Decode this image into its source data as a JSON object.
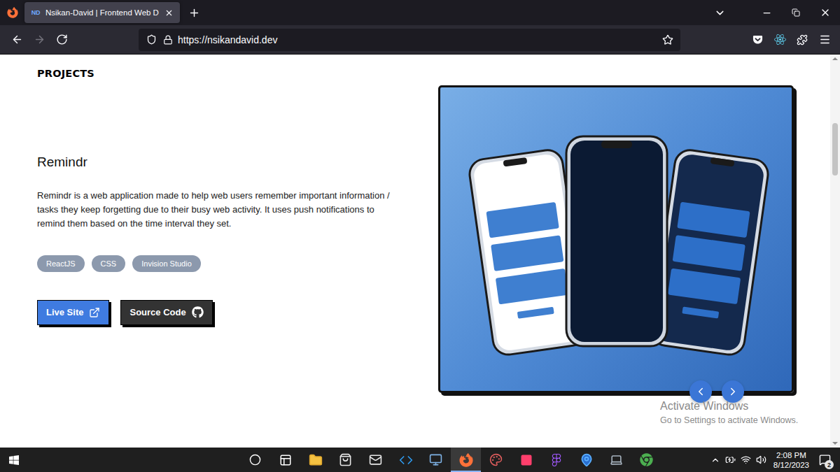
{
  "browser": {
    "tabs": [
      {
        "favicon": "ND",
        "title": "Nsikan-David | Frontend Web D",
        "selected": true
      }
    ],
    "nav_buttons": [
      {
        "kind": "back",
        "disabled": false
      },
      {
        "kind": "forward",
        "disabled": true
      },
      {
        "kind": "reload",
        "disabled": false
      }
    ],
    "url": "https://nsikandavid.dev",
    "bookmarked": false
  },
  "page": {
    "section_title": "PROJECTS",
    "project": {
      "title": "Remindr",
      "description": "Remindr is a web application made to help web users remember important information / tasks they keep forgetting due to their busy web activity. It uses push notifications to remind them based on the time interval they set.",
      "tags": [
        "ReactJS",
        "CSS",
        "Invision Studio"
      ],
      "buttons": [
        {
          "label": "Live Site",
          "kind": "primary"
        },
        {
          "label": "Source Code",
          "kind": "secondary"
        }
      ]
    },
    "scrollbar": {
      "level": 0.2
    }
  },
  "watermark": {
    "title": "Activate Windows",
    "subtitle": "Go to Settings to activate Windows."
  },
  "taskbar": {
    "apps": [
      {
        "kind": "search",
        "active": false
      },
      {
        "kind": "taskview",
        "active": false
      },
      {
        "kind": "explorer",
        "active": false
      },
      {
        "kind": "store",
        "active": false
      },
      {
        "kind": "mail",
        "active": false
      },
      {
        "kind": "vscode",
        "active": false
      },
      {
        "kind": "remote",
        "active": false
      },
      {
        "kind": "firefox",
        "active": true
      },
      {
        "kind": "sketch",
        "active": false
      },
      {
        "kind": "pinkapp",
        "active": false
      },
      {
        "kind": "figma",
        "active": false
      },
      {
        "kind": "pin",
        "active": false
      },
      {
        "kind": "device",
        "active": false
      },
      {
        "kind": "chrome",
        "active": false
      }
    ],
    "time": "2:08 PM",
    "date": "8/12/2023",
    "notifications": "2"
  }
}
